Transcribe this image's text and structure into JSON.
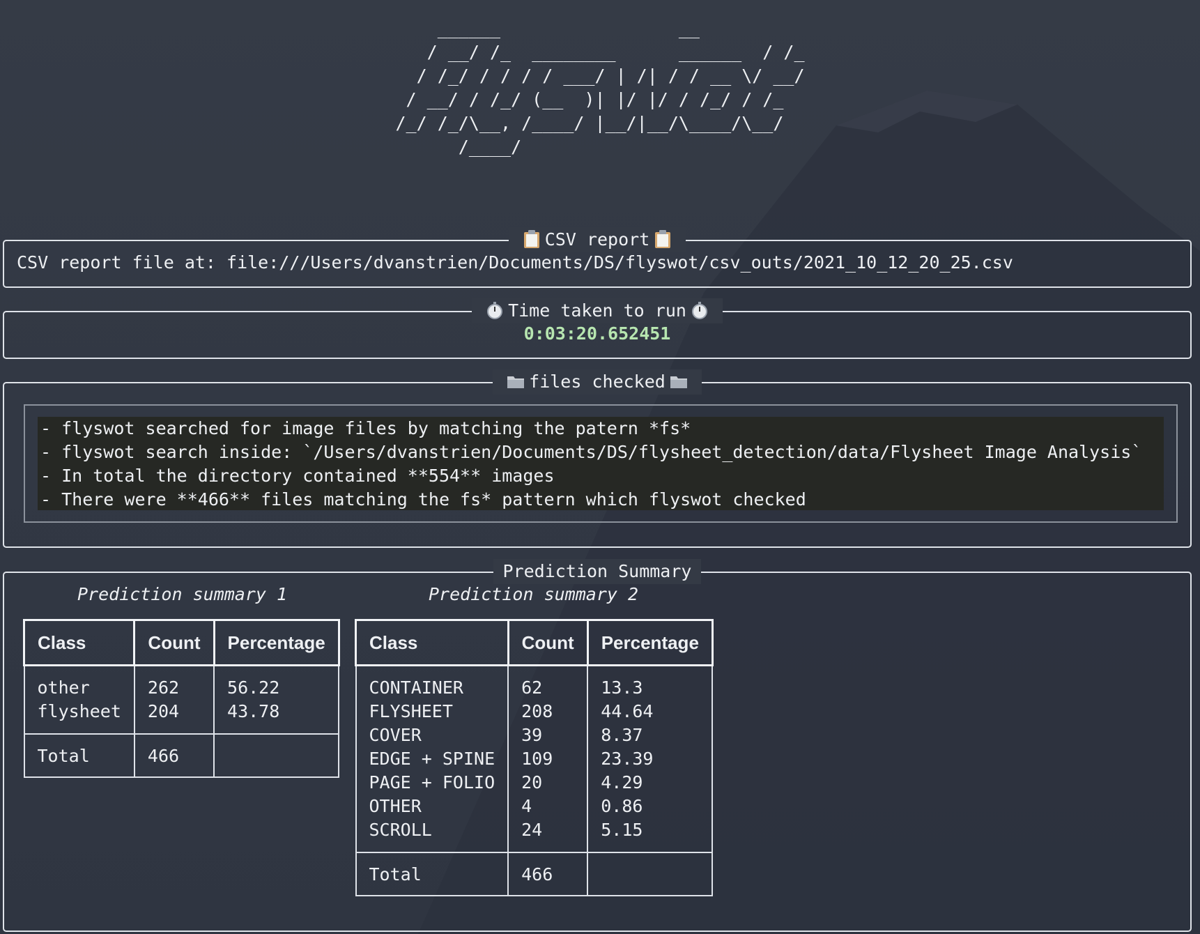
{
  "banner": {
    "ascii_art": "    ______                 __\n   / __/ /_  ________      ______  / /_\n  / /_/ / / / / ___/ | /| / / __ \\/ __/\n / __/ / /_/ (__  )| |/ |/ / /_/ / /_\n/_/ /_/\\__, /____/ |__/|__/\\____/\\__/\n      /____/"
  },
  "csv_report": {
    "title": "CSV report",
    "icon": "clipboard-icon",
    "text": "CSV report file at: file:///Users/dvanstrien/Documents/DS/flyswot/csv_outs/2021_10_12_20_25.csv"
  },
  "time_taken": {
    "title": "Time taken to run",
    "icon": "stopwatch-icon",
    "value": "0:03:20.652451",
    "value_color": "#b7e6b0"
  },
  "files_checked": {
    "title": "files checked",
    "icon": "folder-icon",
    "lines": [
      "- flyswot searched for image files by matching the patern *fs*",
      "- flyswot search inside: `/Users/dvanstrien/Documents/DS/flysheet_detection/data/Flysheet Image Analysis`",
      "- In total the directory contained **554** images",
      "- There were **466** files matching the fs* pattern which flyswot checked"
    ]
  },
  "prediction_summary": {
    "title": "Prediction Summary",
    "tables": [
      {
        "caption": "Prediction summary 1",
        "headers": [
          "Class",
          "Count",
          "Percentage"
        ],
        "classes": "other\nflysheet",
        "counts": "262\n204",
        "percentages": "56.22\n43.78",
        "total_label": "Total",
        "total_count": "466",
        "total_percentage": ""
      },
      {
        "caption": "Prediction summary 2",
        "headers": [
          "Class",
          "Count",
          "Percentage"
        ],
        "classes": "CONTAINER\nFLYSHEET\nCOVER\nEDGE + SPINE\nPAGE + FOLIO\nOTHER\nSCROLL",
        "counts": "62\n208\n39\n109\n20\n4\n24",
        "percentages": "13.3\n44.64\n8.37\n23.39\n4.29\n0.86\n5.15",
        "total_label": "Total",
        "total_count": "466",
        "total_percentage": ""
      }
    ]
  }
}
